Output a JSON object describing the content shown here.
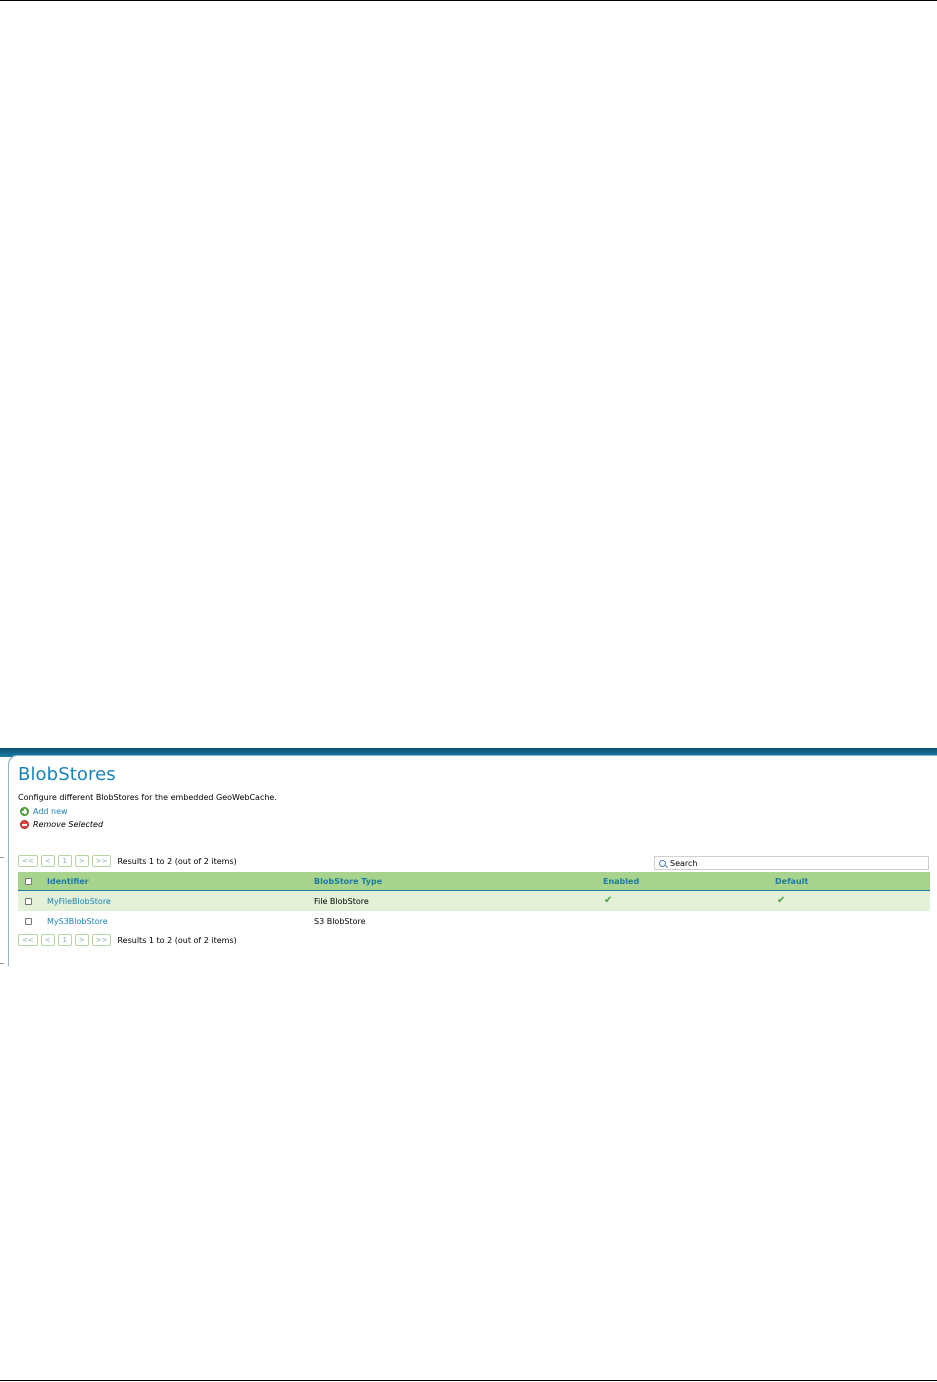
{
  "page": {
    "title": "BlobStores",
    "description": "Configure different BlobStores for the embedded GeoWebCache.",
    "actions": {
      "add_new": "Add new",
      "remove_selected": "Remove Selected"
    }
  },
  "pager": {
    "first": "<<",
    "prev": "<",
    "current_page": "1",
    "next": ">",
    "last": ">>",
    "results_text": "Results 1 to 2 (out of 2 items)"
  },
  "search": {
    "placeholder": "Search",
    "icon": "search-icon"
  },
  "table": {
    "columns": [
      "Identifier",
      "BlobStore Type",
      "Enabled",
      "Default"
    ],
    "rows": [
      {
        "identifier": "MyFileBlobStore",
        "type": "File BlobStore",
        "enabled": "✔",
        "default": "✔"
      },
      {
        "identifier": "MyS3BlobStore",
        "type": "S3 BlobStore",
        "enabled": "",
        "default": ""
      }
    ]
  },
  "colors": {
    "accent": "#1a82b8",
    "header_green": "#a8d38d",
    "row_green": "#e3f1d8",
    "check_green": "#4aa046",
    "add_icon": "#5fb146",
    "remove_icon": "#e2453c"
  }
}
